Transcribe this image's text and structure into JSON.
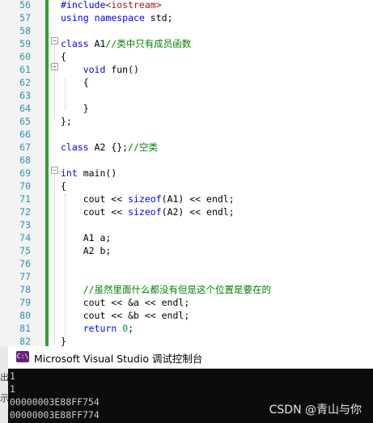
{
  "editor": {
    "lines": [
      {
        "num": "56",
        "parts": [
          {
            "t": "#include",
            "c": "kw"
          },
          {
            "t": "<iostream>",
            "c": "str"
          }
        ]
      },
      {
        "num": "57",
        "parts": [
          {
            "t": "using",
            "c": "kw"
          },
          {
            "t": " "
          },
          {
            "t": "namespace",
            "c": "kw"
          },
          {
            "t": " std;"
          }
        ]
      },
      {
        "num": "58",
        "parts": []
      },
      {
        "num": "59",
        "parts": [
          {
            "t": "class",
            "c": "kw"
          },
          {
            "t": " A1"
          },
          {
            "t": "//类中只有成员函数",
            "c": "cm"
          }
        ]
      },
      {
        "num": "60",
        "parts": [
          {
            "t": "{"
          }
        ]
      },
      {
        "num": "61",
        "parts": [
          {
            "t": "    "
          },
          {
            "t": "void",
            "c": "kw"
          },
          {
            "t": " fun()"
          }
        ]
      },
      {
        "num": "62",
        "parts": [
          {
            "t": "    {"
          }
        ]
      },
      {
        "num": "63",
        "parts": []
      },
      {
        "num": "64",
        "parts": [
          {
            "t": "    }"
          }
        ]
      },
      {
        "num": "65",
        "parts": [
          {
            "t": "};"
          }
        ]
      },
      {
        "num": "66",
        "parts": []
      },
      {
        "num": "67",
        "parts": [
          {
            "t": "class",
            "c": "kw"
          },
          {
            "t": " A2 {};"
          },
          {
            "t": "//空类",
            "c": "cm"
          }
        ]
      },
      {
        "num": "68",
        "parts": []
      },
      {
        "num": "69",
        "parts": [
          {
            "t": "int",
            "c": "kw"
          },
          {
            "t": " main()"
          }
        ]
      },
      {
        "num": "70",
        "parts": [
          {
            "t": "{"
          }
        ]
      },
      {
        "num": "71",
        "parts": [
          {
            "t": "    cout << "
          },
          {
            "t": "sizeof",
            "c": "kw"
          },
          {
            "t": "(A1) << endl;"
          }
        ]
      },
      {
        "num": "72",
        "parts": [
          {
            "t": "    cout << "
          },
          {
            "t": "sizeof",
            "c": "kw"
          },
          {
            "t": "(A2) << endl;"
          }
        ]
      },
      {
        "num": "73",
        "parts": []
      },
      {
        "num": "74",
        "parts": [
          {
            "t": "    A1 a;"
          }
        ]
      },
      {
        "num": "75",
        "parts": [
          {
            "t": "    A2 b;"
          }
        ]
      },
      {
        "num": "76",
        "parts": []
      },
      {
        "num": "77",
        "parts": []
      },
      {
        "num": "78",
        "parts": [
          {
            "t": "    "
          },
          {
            "t": "//虽然里面什么都没有但是这个位置是要在的",
            "c": "cm"
          }
        ]
      },
      {
        "num": "79",
        "parts": [
          {
            "t": "    cout << &a << endl;"
          }
        ]
      },
      {
        "num": "80",
        "parts": [
          {
            "t": "    cout << &b << endl;"
          }
        ]
      },
      {
        "num": "81",
        "parts": [
          {
            "t": "    "
          },
          {
            "t": "return",
            "c": "kw"
          },
          {
            "t": " "
          },
          {
            "t": "0",
            "c": "num"
          },
          {
            "t": ";"
          }
        ]
      },
      {
        "num": "82",
        "parts": [
          {
            "t": "}"
          }
        ]
      }
    ]
  },
  "console": {
    "icon_text": "C:\\",
    "title": "Microsoft Visual Studio 调试控制台",
    "output": [
      "1",
      "1",
      "00000003E88FF754",
      "00000003E88FF774"
    ]
  },
  "left_strip": {
    "top": "出",
    "bottom": "示"
  },
  "watermark": "CSDN @青山与你",
  "colors": {
    "keyword": "#0000ff",
    "string": "#a31515",
    "comment": "#008000",
    "line_number": "#2b91af",
    "change_bar": "#2e9e2e"
  }
}
